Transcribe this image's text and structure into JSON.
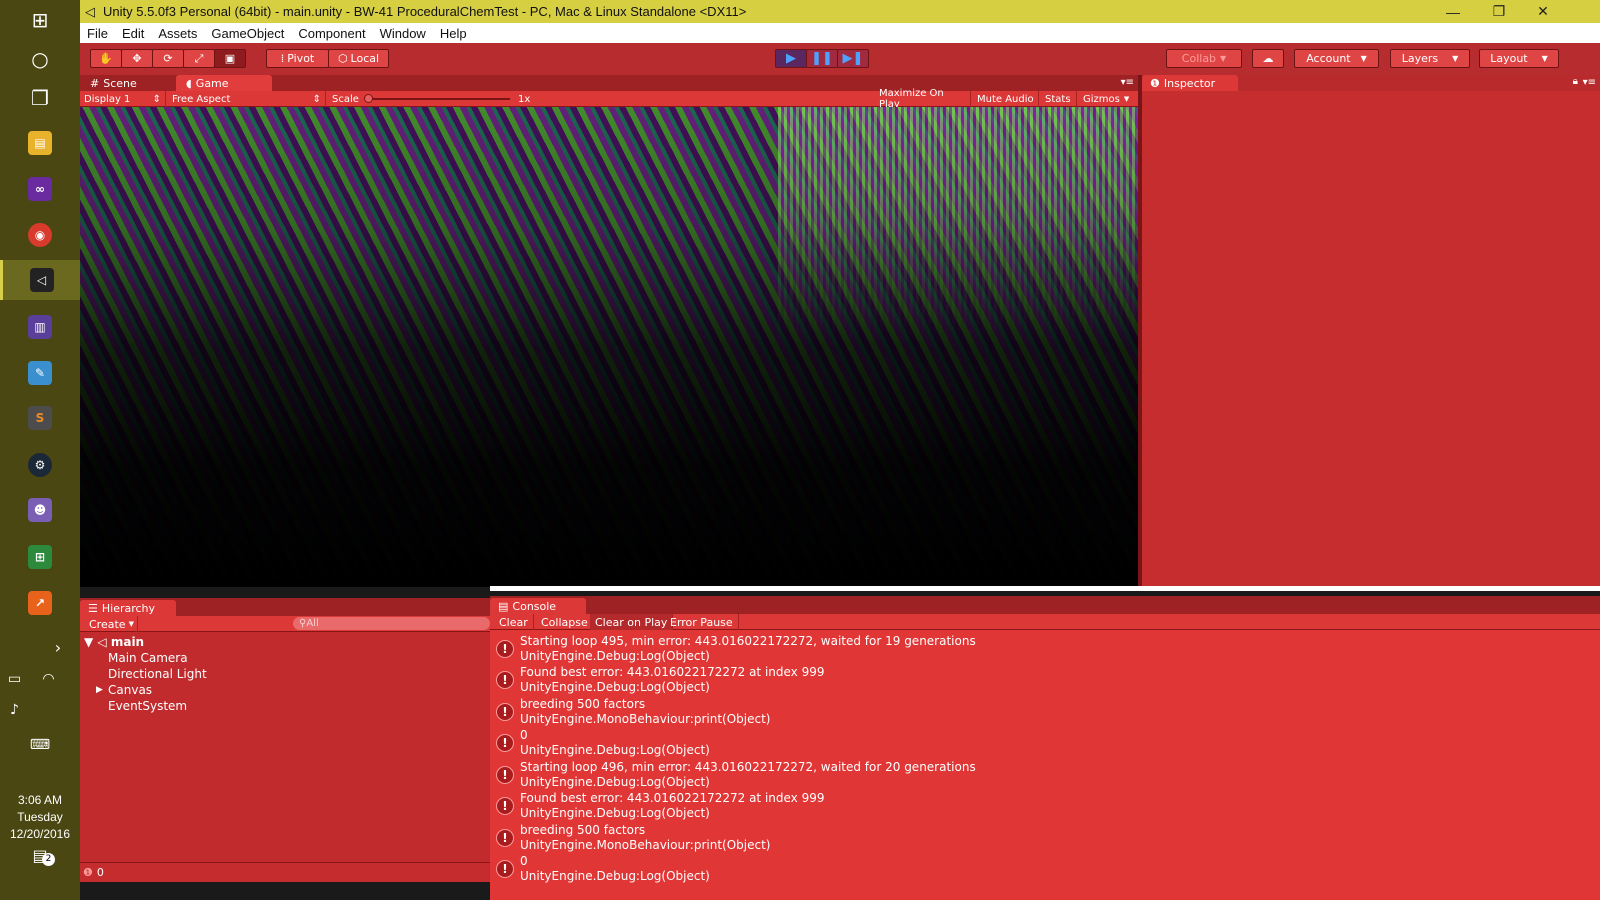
{
  "window": {
    "title": "Unity 5.5.0f3 Personal (64bit) - main.unity - BW-41 ProceduralChemTest - PC, Mac & Linux Standalone <DX11>",
    "minimize": "—",
    "restore": "❐",
    "close": "✕"
  },
  "menu": [
    "File",
    "Edit",
    "Assets",
    "GameObject",
    "Component",
    "Window",
    "Help"
  ],
  "toolbar": {
    "tools": [
      "hand-tool",
      "move-tool",
      "rotate-tool",
      "scale-tool",
      "rect-tool"
    ],
    "pivot": "Pivot",
    "local": "Local",
    "collab": "Collab",
    "account": "Account",
    "layers": "Layers",
    "layout": "Layout"
  },
  "scene_tabs": {
    "scene": "Scene",
    "game": "Game"
  },
  "game_bar": {
    "display": "Display 1",
    "aspect": "Free Aspect",
    "scale_label": "Scale",
    "scale_value": "1x",
    "maximize": "Maximize On Play",
    "mute": "Mute Audio",
    "stats": "Stats",
    "gizmos": "Gizmos"
  },
  "inspector": {
    "tab": "Inspector"
  },
  "hierarchy": {
    "tab": "Hierarchy",
    "create": "Create",
    "search_placeholder": "All",
    "scene": "main",
    "items": [
      "Main Camera",
      "Directional Light",
      "Canvas",
      "EventSystem"
    ],
    "error_count": "0"
  },
  "console": {
    "tab": "Console",
    "buttons": [
      "Clear",
      "Collapse",
      "Clear on Play",
      "Error Pause"
    ],
    "entries": [
      {
        "line1": "Starting loop 495, min error: 443.016022172272, waited for 19 generations",
        "line2": "UnityEngine.Debug:Log(Object)"
      },
      {
        "line1": "Found best error: 443.016022172272 at index 999",
        "line2": "UnityEngine.Debug:Log(Object)"
      },
      {
        "line1": "breeding 500 factors",
        "line2": "UnityEngine.MonoBehaviour:print(Object)"
      },
      {
        "line1": "0",
        "line2": "UnityEngine.Debug:Log(Object)"
      },
      {
        "line1": "Starting loop 496, min error: 443.016022172272, waited for 20 generations",
        "line2": "UnityEngine.Debug:Log(Object)"
      },
      {
        "line1": "Found best error: 443.016022172272 at index 999",
        "line2": "UnityEngine.Debug:Log(Object)"
      },
      {
        "line1": "breeding 500 factors",
        "line2": "UnityEngine.MonoBehaviour:print(Object)"
      },
      {
        "line1": "0",
        "line2": "UnityEngine.Debug:Log(Object)"
      }
    ]
  },
  "taskbar": {
    "clock": {
      "time": "3:06 AM",
      "day": "Tuesday",
      "date": "12/20/2016"
    },
    "notifications": "2"
  }
}
